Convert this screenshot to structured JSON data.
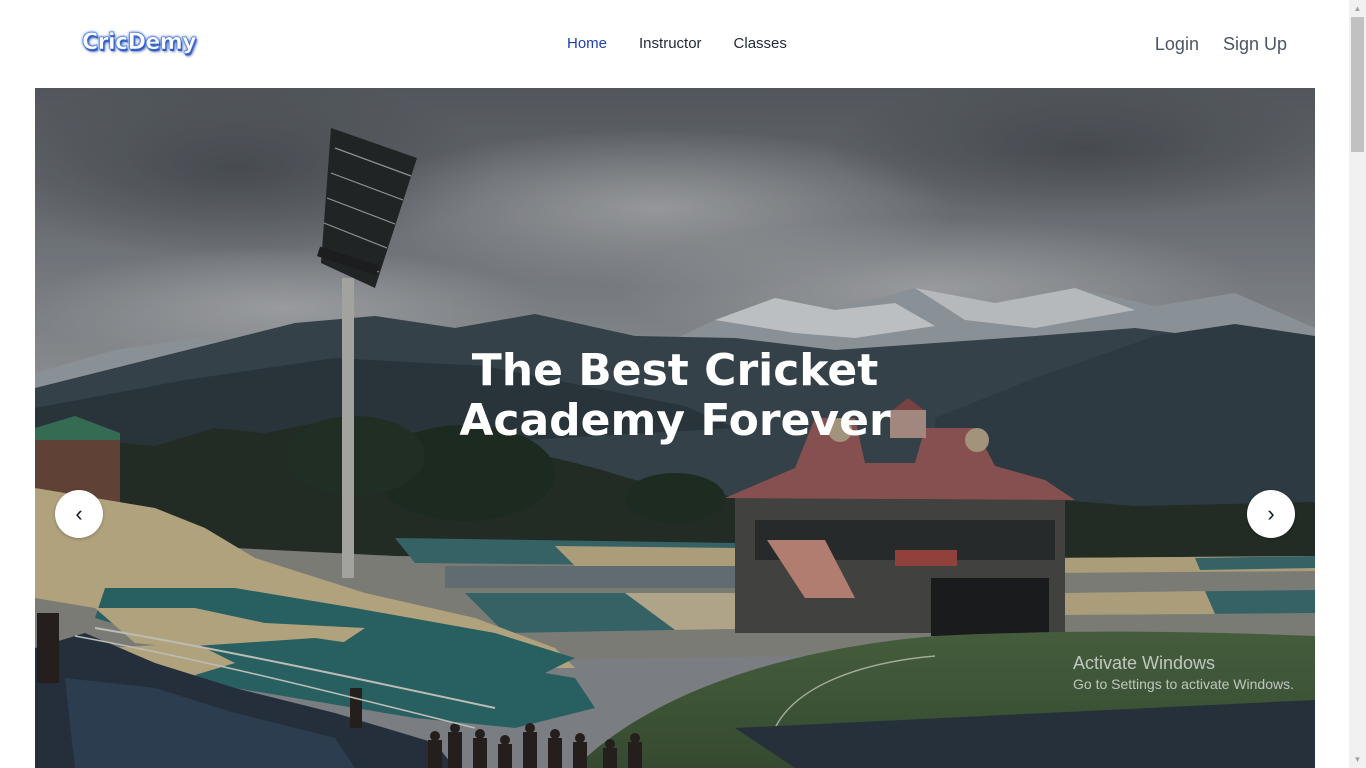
{
  "brand": {
    "logo_text": "CricDemy"
  },
  "nav": {
    "links": [
      {
        "label": "Home",
        "active": true
      },
      {
        "label": "Instructor",
        "active": false
      },
      {
        "label": "Classes",
        "active": false
      }
    ],
    "login_label": "Login",
    "signup_label": "Sign Up"
  },
  "hero": {
    "title_line1": "The Best Cricket",
    "title_line2": "Academy Forever",
    "prev_glyph": "‹",
    "next_glyph": "›"
  },
  "watermark": {
    "title": "Activate Windows",
    "subtitle": "Go to Settings to activate Windows."
  },
  "scrollbar": {
    "up_glyph": "▲",
    "down_glyph": "▼"
  },
  "colors": {
    "nav_active": "#1e40af",
    "nav_text": "#1f2937",
    "auth_text": "#4b5563",
    "logo_blue": "#3f6fd6"
  }
}
